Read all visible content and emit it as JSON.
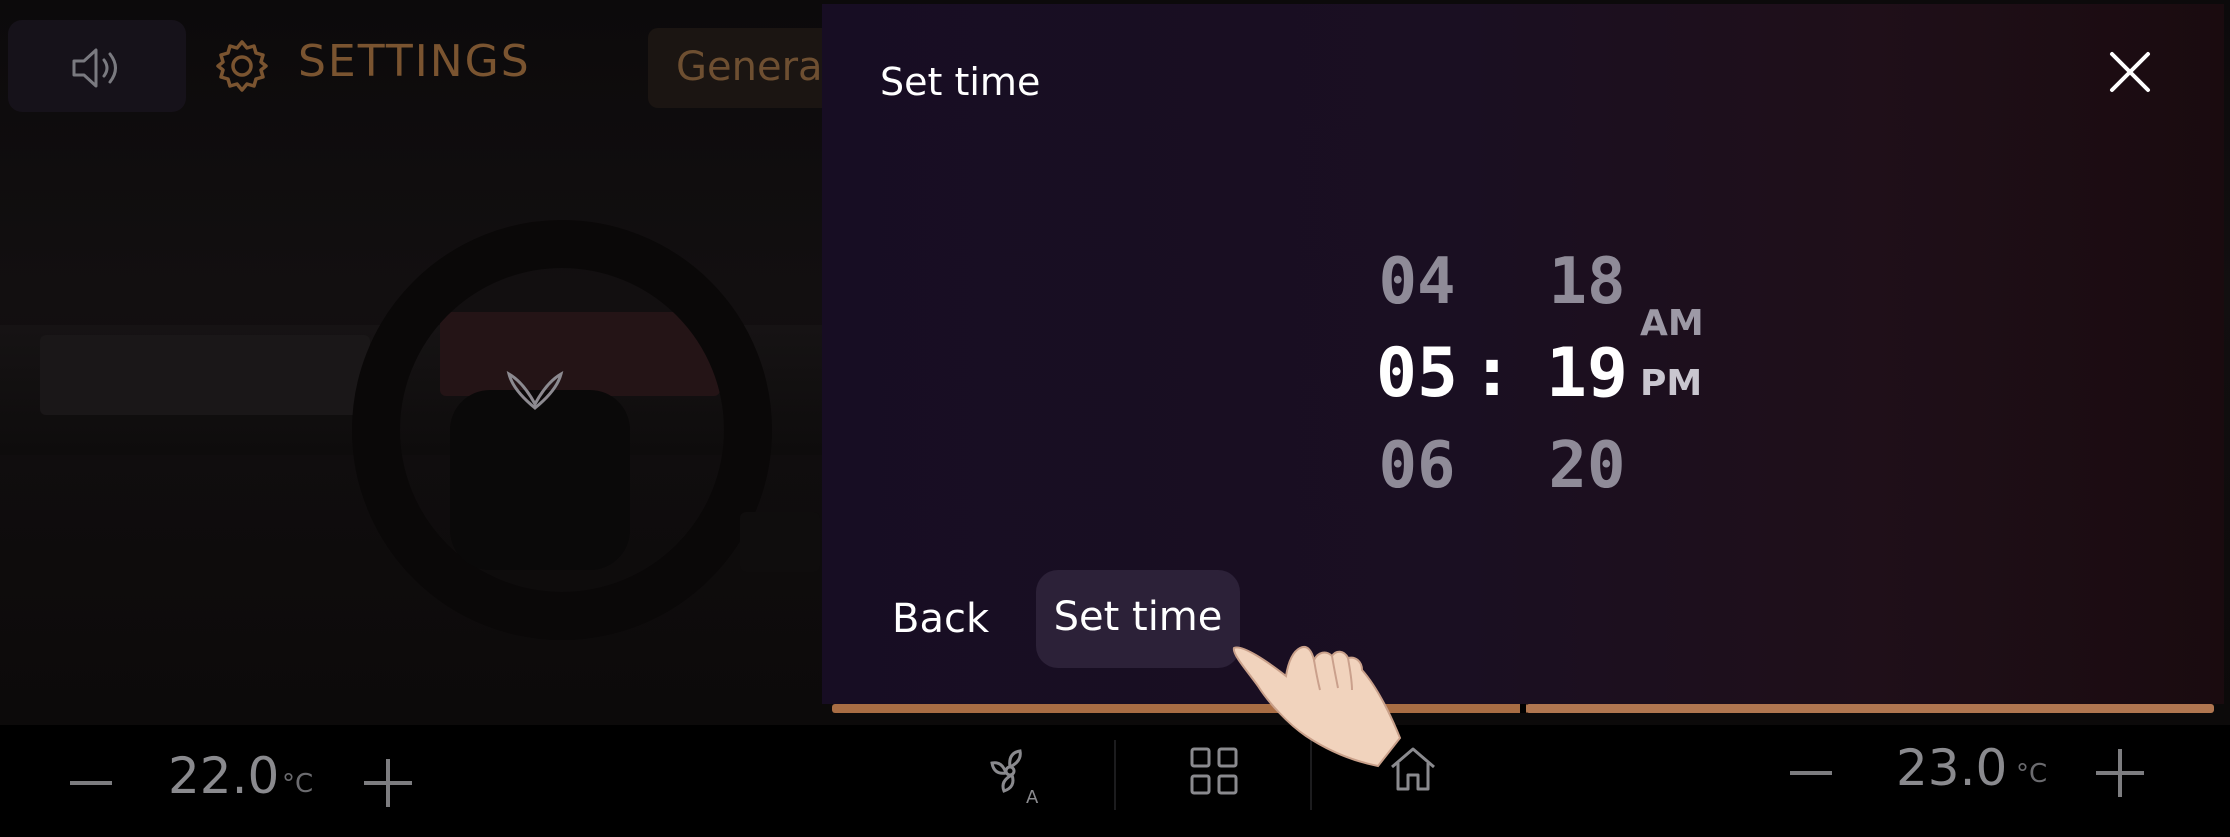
{
  "header": {
    "settings_title": "SETTINGS",
    "general_tab": "General",
    "volume_icon": "speaker-icon",
    "settings_icon": "gear-icon"
  },
  "modal": {
    "title": "Set time",
    "close_icon": "close-icon",
    "hours": [
      "04",
      "05",
      "06"
    ],
    "minutes": [
      "18",
      "19",
      "20"
    ],
    "separator": ":",
    "am_label": "AM",
    "pm_label": "PM",
    "back_label": "Back",
    "set_label": "Set time"
  },
  "climate": {
    "left_temp": "22.0",
    "left_unit": "°C",
    "right_temp": "23.0",
    "right_unit": "°C",
    "icons": [
      "fan-auto-icon",
      "apps-grid-icon",
      "home-icon"
    ]
  },
  "colors": {
    "accent": "#a86d44",
    "selected_button": "#2c2138",
    "settings_text": "#7a5430"
  }
}
